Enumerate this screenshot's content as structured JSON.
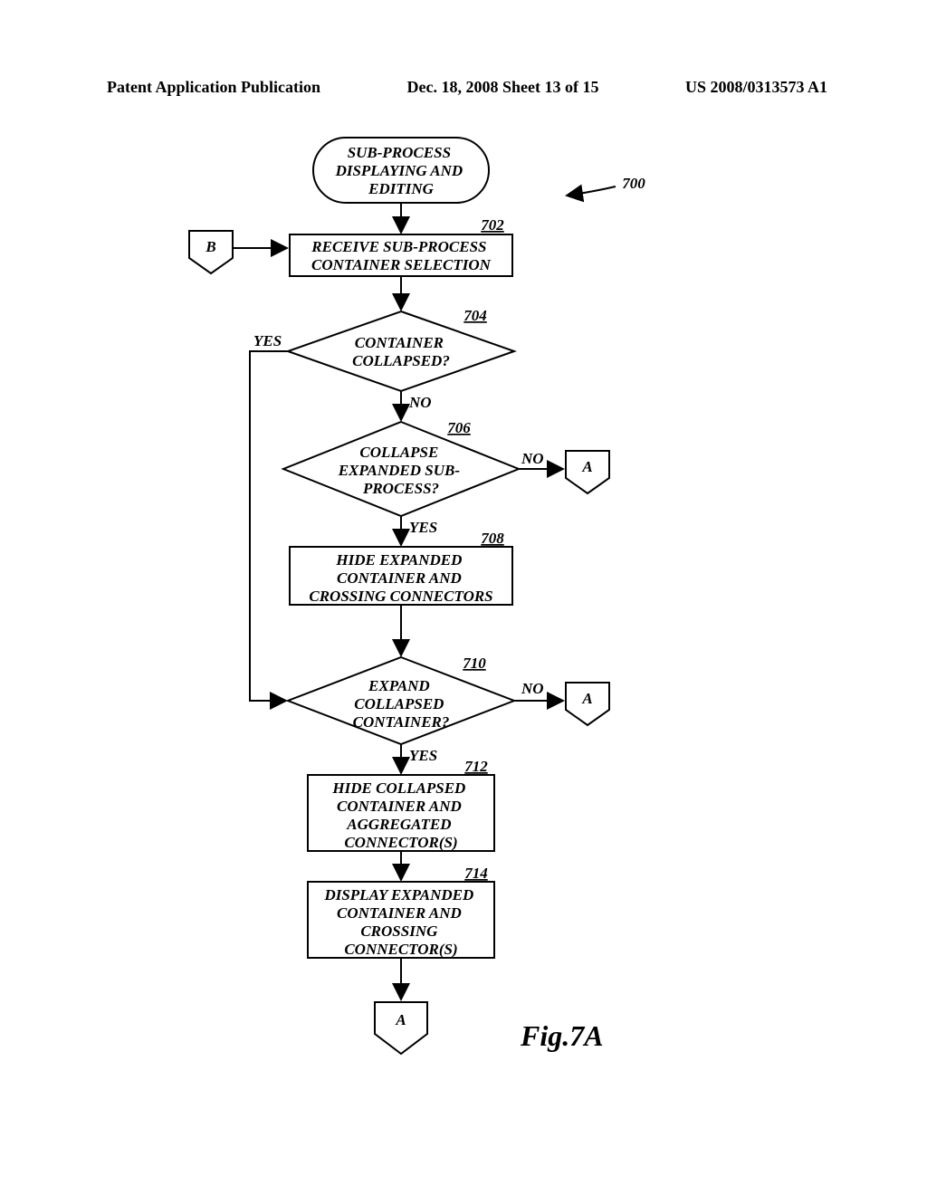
{
  "header": {
    "left": "Patent Application Publication",
    "center": "Dec. 18, 2008  Sheet 13 of 15",
    "right": "US 2008/0313573 A1"
  },
  "flowchart": {
    "title": "SUB-PROCESS DISPLAYING AND EDITING",
    "ref_overall": "700",
    "connector_B": "B",
    "box702": {
      "text": "RECEIVE SUB-PROCESS CONTAINER SELECTION",
      "ref": "702"
    },
    "decision704": {
      "text": "CONTAINER COLLAPSED?",
      "ref": "704",
      "yes": "YES",
      "no": "NO"
    },
    "decision706": {
      "text": "COLLAPSE EXPANDED SUB-PROCESS?",
      "ref": "706",
      "yes": "YES",
      "no": "NO"
    },
    "connector_A1": "A",
    "box708": {
      "text": "HIDE EXPANDED CONTAINER AND CROSSING CONNECTORS",
      "ref": "708"
    },
    "decision710": {
      "text": "EXPAND COLLAPSED CONTAINER?",
      "ref": "710",
      "yes": "YES",
      "no": "NO"
    },
    "connector_A2": "A",
    "box712": {
      "text": "HIDE COLLAPSED CONTAINER AND AGGREGATED CONNECTOR(S)",
      "ref": "712"
    },
    "box714": {
      "text": "DISPLAY EXPANDED CONTAINER AND CROSSING CONNECTOR(S)",
      "ref": "714"
    },
    "connector_A_end": "A"
  },
  "figure_label": "Fig.7A"
}
